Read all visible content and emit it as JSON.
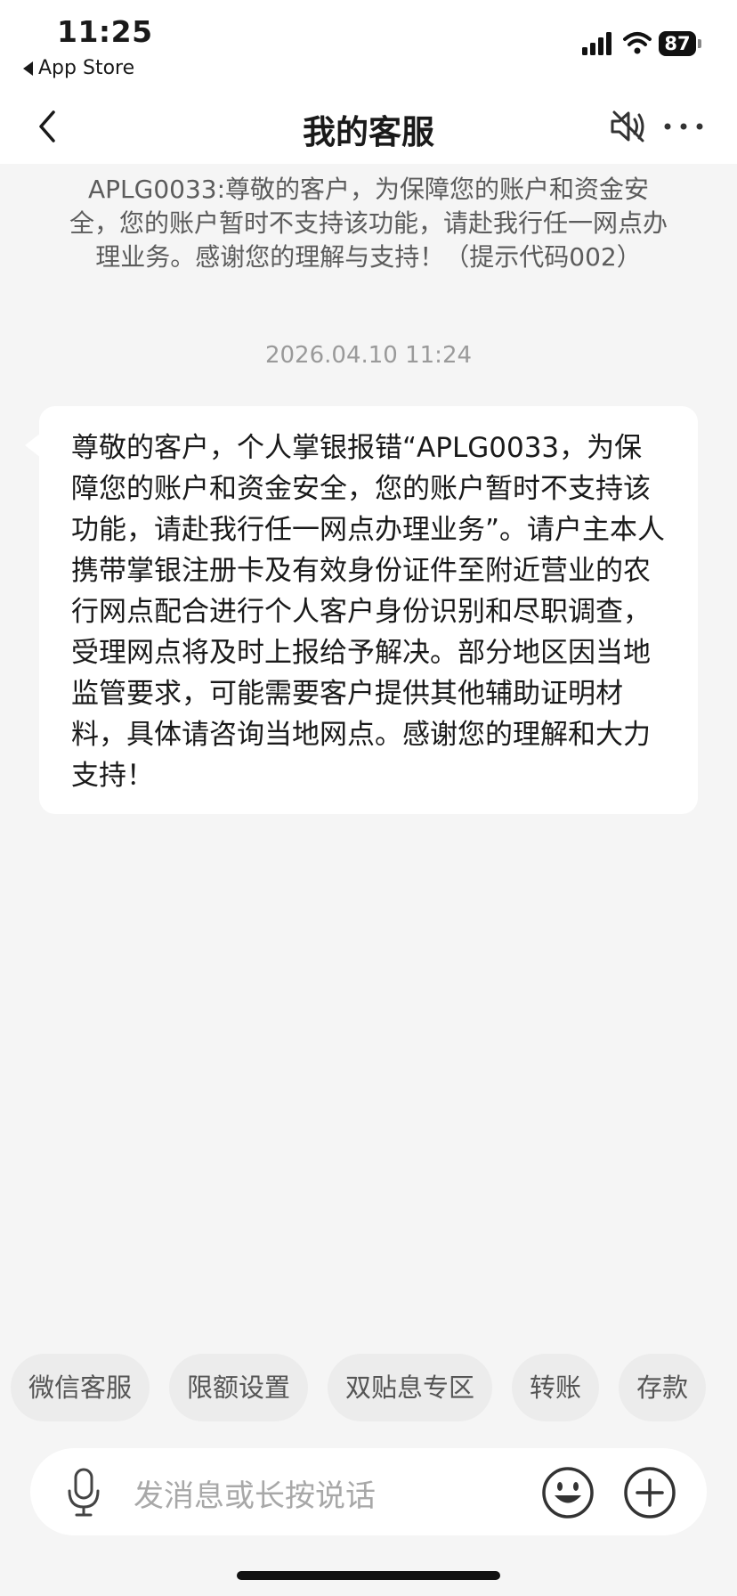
{
  "status_bar": {
    "time": "11:25",
    "back_app": "App Store",
    "battery": "87"
  },
  "nav": {
    "title": "我的客服",
    "icons": [
      "back-chevron-icon",
      "mute-speaker-icon",
      "more-dots-icon"
    ]
  },
  "chat": {
    "system_message": "APLG0033:尊敬的客户，为保障您的账户和资金安全，您的账户暂时不支持该功能，请赴我行任一网点办理业务。感谢您的理解与支持！（提示代码002）",
    "timestamp": "2026.04.10 11:24",
    "reply": "尊敬的客户，个人掌银报错“APLG0033，为保障您的账户和资金安全，您的账户暂时不支持该功能，请赴我行任一网点办理业务”。请户主本人携带掌银注册卡及有效身份证件至附近营业的农行网点配合进行个人客户身份识别和尽职调查，受理网点将及时上报给予解决。部分地区因当地监管要求，可能需要客户提供其他辅助证明材料，具体请咨询当地网点。感谢您的理解和大力支持！"
  },
  "quick_chips": [
    "微信客服",
    "限额设置",
    "双贴息专区",
    "转账",
    "存款"
  ],
  "input": {
    "placeholder": "发消息或长按说话",
    "icons": [
      "microphone-icon",
      "emoji-icon",
      "plus-icon"
    ]
  },
  "colors": {
    "background": "#f5f5f5",
    "bubble": "#ffffff",
    "chip": "#ececec",
    "muted_text": "#9a9a9a"
  }
}
